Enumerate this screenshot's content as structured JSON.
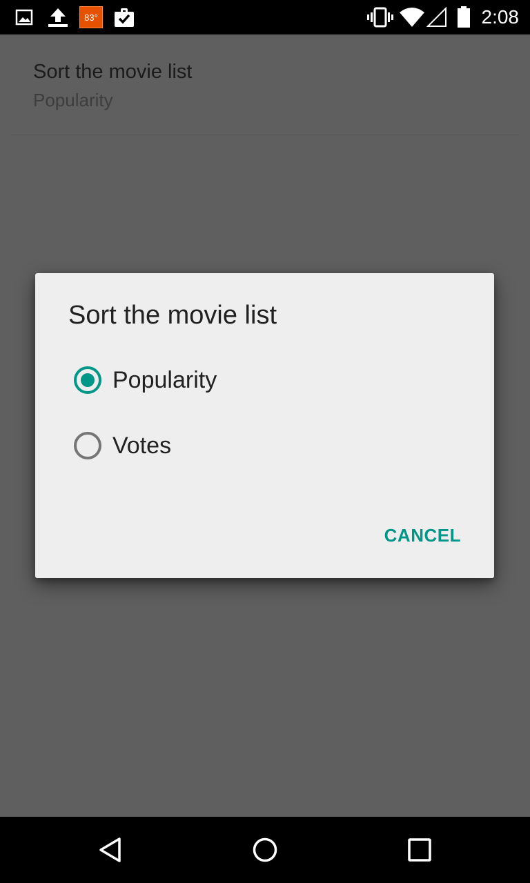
{
  "status_bar": {
    "time": "2:08",
    "weather_temp": "83°",
    "icons": [
      "image-icon",
      "upload-icon",
      "weather-icon",
      "task-icon",
      "vibrate-icon",
      "wifi-icon",
      "signal-icon",
      "battery-icon"
    ]
  },
  "settings": {
    "pref_title": "Sort the movie list",
    "pref_summary": "Popularity"
  },
  "dialog": {
    "title": "Sort the movie list",
    "options": [
      {
        "label": "Popularity",
        "selected": true
      },
      {
        "label": "Votes",
        "selected": false
      }
    ],
    "cancel_label": "CANCEL"
  },
  "nav_bar": {
    "icons": [
      "back-icon",
      "home-icon",
      "recents-icon"
    ]
  },
  "colors": {
    "accent": "#009688",
    "scrim": "#5f5f5f",
    "dialog_bg": "#eeeeee"
  }
}
